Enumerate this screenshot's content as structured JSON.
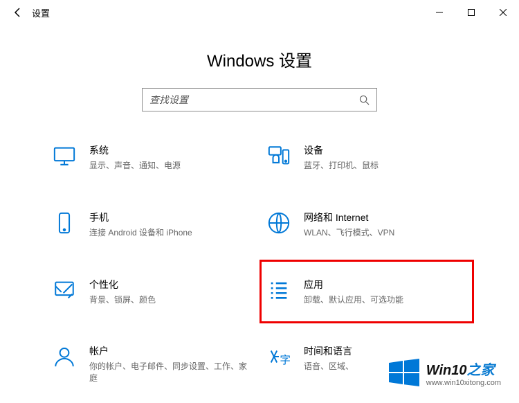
{
  "window": {
    "title": "设置"
  },
  "heading": "Windows 设置",
  "search": {
    "placeholder": "查找设置"
  },
  "cards": {
    "system": {
      "label": "系统",
      "sub": "显示、声音、通知、电源"
    },
    "devices": {
      "label": "设备",
      "sub": "蓝牙、打印机、鼠标"
    },
    "phone": {
      "label": "手机",
      "sub": "连接 Android 设备和 iPhone"
    },
    "network": {
      "label": "网络和 Internet",
      "sub": "WLAN、飞行模式、VPN"
    },
    "personalization": {
      "label": "个性化",
      "sub": "背景、锁屏、颜色"
    },
    "apps": {
      "label": "应用",
      "sub": "卸载、默认应用、可选功能"
    },
    "accounts": {
      "label": "帐户",
      "sub": "你的帐户、电子邮件、同步设置、工作、家庭"
    },
    "language": {
      "label": "时间和语言",
      "sub": "语音、区域、"
    }
  },
  "watermark": {
    "brand_prefix": "Win10",
    "brand_suffix": "之家",
    "url": "www.win10xitong.com"
  },
  "colors": {
    "accent": "#0078D7",
    "highlight": "#ef0000"
  }
}
